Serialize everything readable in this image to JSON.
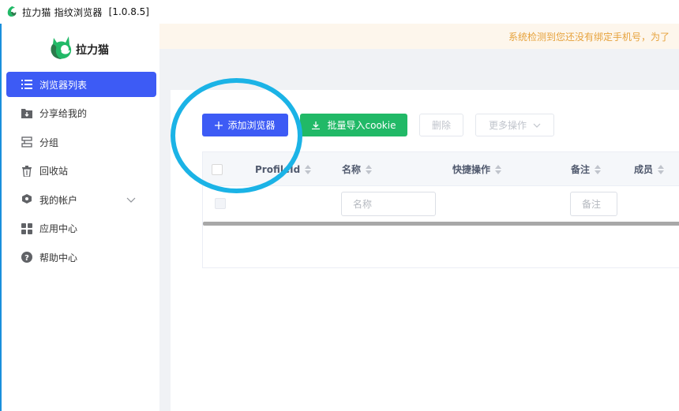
{
  "window": {
    "title": "拉力猫 指纹浏览器",
    "version": "[1.0.8.5]"
  },
  "brand": {
    "name": "拉力猫",
    "accent_color": "#21b967"
  },
  "sidebar": {
    "items": [
      {
        "label": "浏览器列表",
        "icon": "list-icon",
        "active": true
      },
      {
        "label": "分享给我的",
        "icon": "shared-folder-icon",
        "active": false
      },
      {
        "label": "分组",
        "icon": "group-icon",
        "active": false
      },
      {
        "label": "回收站",
        "icon": "trash-icon",
        "active": false
      },
      {
        "label": "我的帐户",
        "icon": "account-icon",
        "active": false,
        "expandable": true
      },
      {
        "label": "应用中心",
        "icon": "apps-icon",
        "active": false
      },
      {
        "label": "帮助中心",
        "icon": "help-icon",
        "active": false
      }
    ]
  },
  "banner": {
    "text": "系统检测到您还没有绑定手机号，为了"
  },
  "toolbar": {
    "add_label": "添加浏览器",
    "import_label": "批量导入cookie",
    "delete_label": "删除",
    "more_label": "更多操作"
  },
  "table": {
    "columns": [
      "ProfileId",
      "名称",
      "快捷操作",
      "备注",
      "成员"
    ],
    "filters": {
      "name_placeholder": "名称",
      "note_placeholder": "备注"
    }
  },
  "colors": {
    "primary": "#3d5bf5",
    "success": "#21b967",
    "warning_text": "#e6a23c",
    "annotation": "#1bb3e6"
  }
}
